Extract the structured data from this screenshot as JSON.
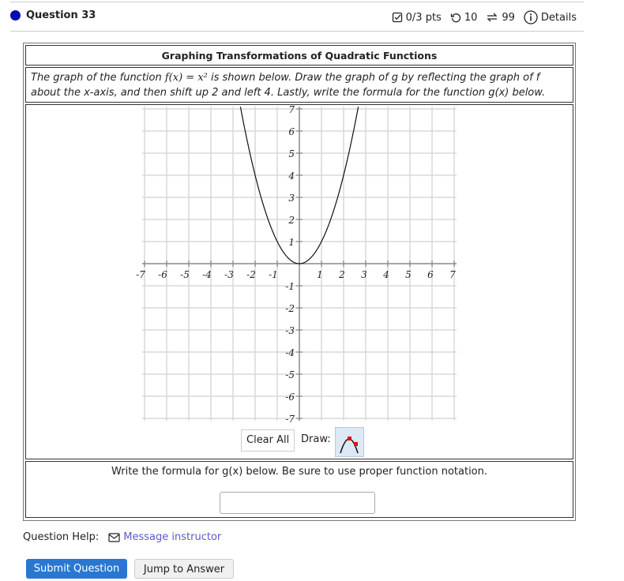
{
  "question": {
    "label": "Question 33",
    "status_color": "#0b0bb0"
  },
  "meta": {
    "score": "0/3 pts",
    "retries": "10",
    "attempts": "99",
    "details": "Details"
  },
  "problem": {
    "title": "Graphing Transformations of Quadratic Functions",
    "prompt_part1": "The graph of the function ",
    "prompt_math": "f(x) = x²",
    "prompt_part2": " is shown below. Draw the graph of g by reflecting the graph of f",
    "prompt_line2": "about the x-axis, and then shift up 2 and left 4. Lastly, write the formula for the function g(x) below."
  },
  "graph": {
    "x_range": [
      -7,
      7
    ],
    "y_range": [
      -7,
      7
    ],
    "x_ticks": [
      "-7",
      "-6",
      "-5",
      "-4",
      "-3",
      "-2",
      "-1",
      "1",
      "2",
      "3",
      "4",
      "5",
      "6",
      "7"
    ],
    "y_ticks": [
      "7",
      "6",
      "5",
      "4",
      "3",
      "2",
      "1",
      "-1",
      "-2",
      "-3",
      "-4",
      "-5",
      "-6",
      "-7"
    ],
    "function": "x^2",
    "clear_label": "Clear All",
    "draw_label": "Draw:",
    "tool": "parabola-tool"
  },
  "answer": {
    "label": "Write the formula for g(x) below. Be sure to use proper function notation.",
    "value": "",
    "placeholder": ""
  },
  "help": {
    "label": "Question Help:",
    "link": "Message instructor"
  },
  "buttons": {
    "submit": "Submit Question",
    "jump": "Jump to Answer"
  }
}
